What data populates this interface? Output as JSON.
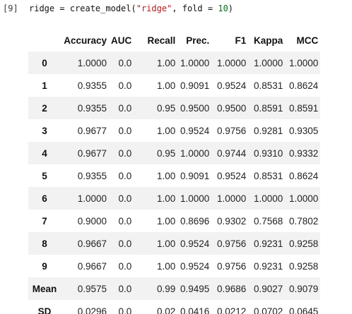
{
  "cell": {
    "prompt": "[9]",
    "code_var": "ridge",
    "code_assign": " = ",
    "code_func": "create_model(",
    "code_arg_str": "\"ridge\"",
    "code_sep": ", fold = ",
    "code_num": "10",
    "code_close": ")"
  },
  "table": {
    "columns": [
      "",
      "Accuracy",
      "AUC",
      "Recall",
      "Prec.",
      "F1",
      "Kappa",
      "MCC"
    ],
    "rows": [
      {
        "index": "0",
        "values": [
          "1.0000",
          "0.0",
          "1.00",
          "1.0000",
          "1.0000",
          "1.0000",
          "1.0000"
        ]
      },
      {
        "index": "1",
        "values": [
          "0.9355",
          "0.0",
          "1.00",
          "0.9091",
          "0.9524",
          "0.8531",
          "0.8624"
        ]
      },
      {
        "index": "2",
        "values": [
          "0.9355",
          "0.0",
          "0.95",
          "0.9500",
          "0.9500",
          "0.8591",
          "0.8591"
        ]
      },
      {
        "index": "3",
        "values": [
          "0.9677",
          "0.0",
          "1.00",
          "0.9524",
          "0.9756",
          "0.9281",
          "0.9305"
        ]
      },
      {
        "index": "4",
        "values": [
          "0.9677",
          "0.0",
          "0.95",
          "1.0000",
          "0.9744",
          "0.9310",
          "0.9332"
        ]
      },
      {
        "index": "5",
        "values": [
          "0.9355",
          "0.0",
          "1.00",
          "0.9091",
          "0.9524",
          "0.8531",
          "0.8624"
        ]
      },
      {
        "index": "6",
        "values": [
          "1.0000",
          "0.0",
          "1.00",
          "1.0000",
          "1.0000",
          "1.0000",
          "1.0000"
        ]
      },
      {
        "index": "7",
        "values": [
          "0.9000",
          "0.0",
          "1.00",
          "0.8696",
          "0.9302",
          "0.7568",
          "0.7802"
        ]
      },
      {
        "index": "8",
        "values": [
          "0.9667",
          "0.0",
          "1.00",
          "0.9524",
          "0.9756",
          "0.9231",
          "0.9258"
        ]
      },
      {
        "index": "9",
        "values": [
          "0.9667",
          "0.0",
          "1.00",
          "0.9524",
          "0.9756",
          "0.9231",
          "0.9258"
        ]
      },
      {
        "index": "Mean",
        "values": [
          "0.9575",
          "0.0",
          "0.99",
          "0.9495",
          "0.9686",
          "0.9027",
          "0.9079"
        ]
      },
      {
        "index": "SD",
        "values": [
          "0.0296",
          "0.0",
          "0.02",
          "0.0416",
          "0.0212",
          "0.0702",
          "0.0645"
        ]
      }
    ]
  },
  "colors": {
    "stripe": "#f2f2f2",
    "string_literal": "#b2191b",
    "number_literal": "#0b6b2c"
  }
}
